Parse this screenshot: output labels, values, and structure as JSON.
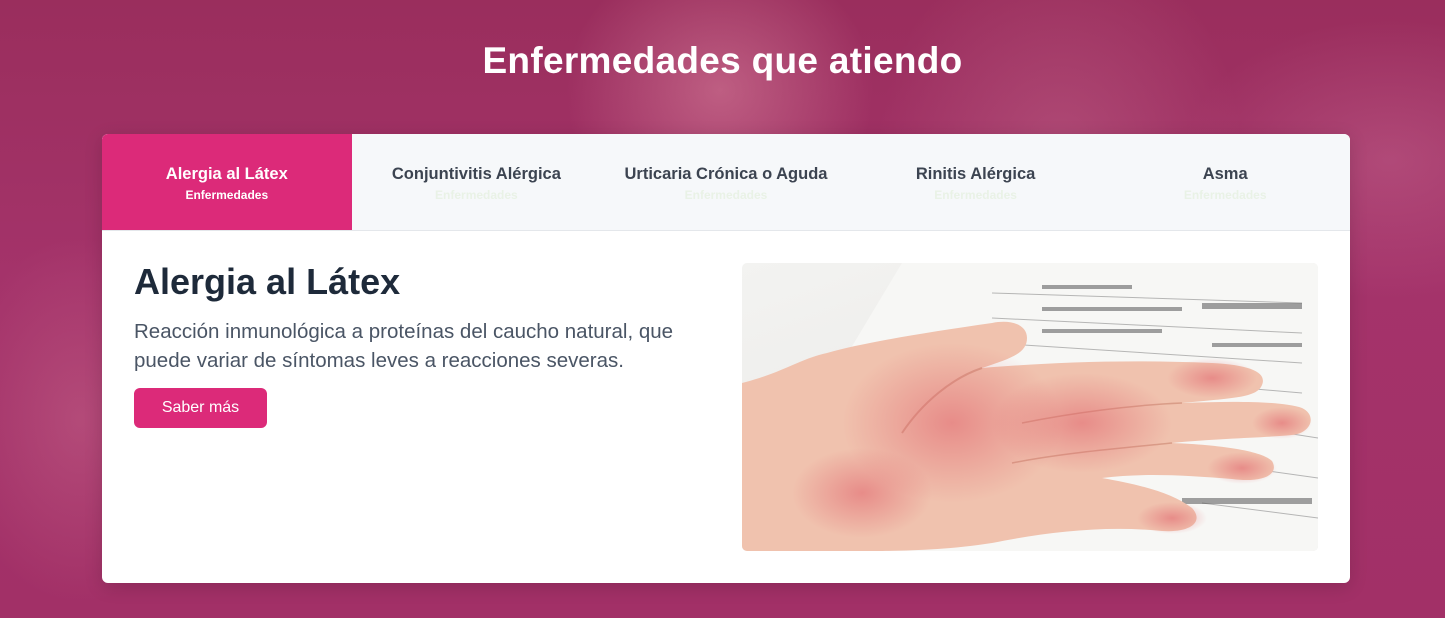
{
  "section": {
    "title": "Enfermedades que atiendo"
  },
  "tabs": [
    {
      "label": "Alergia al Látex",
      "sub": "Enfermedades",
      "active": true
    },
    {
      "label": "Conjuntivitis Alérgica",
      "sub": "Enfermedades",
      "active": false
    },
    {
      "label": "Urticaria Crónica o Aguda",
      "sub": "Enfermedades",
      "active": false
    },
    {
      "label": "Rinitis Alérgica",
      "sub": "Enfermedades",
      "active": false
    },
    {
      "label": "Asma",
      "sub": "Enfermedades",
      "active": false
    }
  ],
  "detail": {
    "title": "Alergia al Látex",
    "description": "Reacción inmunológica a proteínas del caucho natural, que puede variar de síntomas leves a reacciones severas.",
    "button_label": "Saber más",
    "image_alt": "Palma de mano con erupción roja sobre formulario médico"
  },
  "colors": {
    "accent": "#dc2a79",
    "background": "#9b2c5c",
    "heading": "#1e2a3a",
    "text": "#4a5565",
    "tab_bg": "#f6f8fa"
  }
}
